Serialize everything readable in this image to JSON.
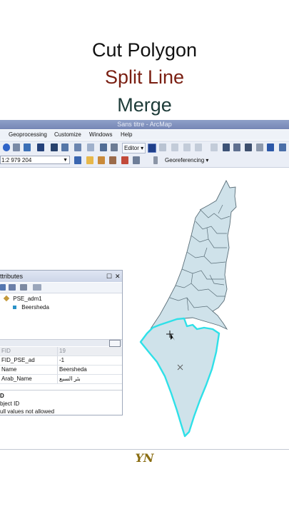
{
  "headline": {
    "line1": "Cut Polygon",
    "line2": "Split Line",
    "line3": "Merge"
  },
  "window": {
    "title": "Sans titre - ArcMap"
  },
  "menu": {
    "items": [
      "Geoprocessing",
      "Customize",
      "Windows",
      "Help"
    ]
  },
  "toolbar": {
    "editor_label": "Editor ▾",
    "scale_value": "1:2 979 204",
    "georeferencing_label": "Georeferencing ▾"
  },
  "attributes_panel": {
    "title": "ttributes",
    "pin_glyph": "☐",
    "close_glyph": "✕",
    "tree": {
      "layer": "PSE_adm1",
      "feature": "Beersheda"
    },
    "rows": [
      {
        "key": "FID",
        "value": "19"
      },
      {
        "key": "FID_PSE_ad",
        "value": "-1"
      },
      {
        "key": "Name",
        "value": "Beersheda"
      },
      {
        "key": "Arab_Name",
        "value": "بئر السبع"
      }
    ],
    "description": {
      "line1": "D",
      "line2": "bject ID",
      "line3": "ull values not allowed"
    }
  },
  "colors": {
    "polygon_fill": "#cfe2ea",
    "polygon_stroke": "#5a6e78",
    "selection_stroke": "#2fe0e8",
    "title_bar": "#8495c0"
  },
  "signature": "YN"
}
